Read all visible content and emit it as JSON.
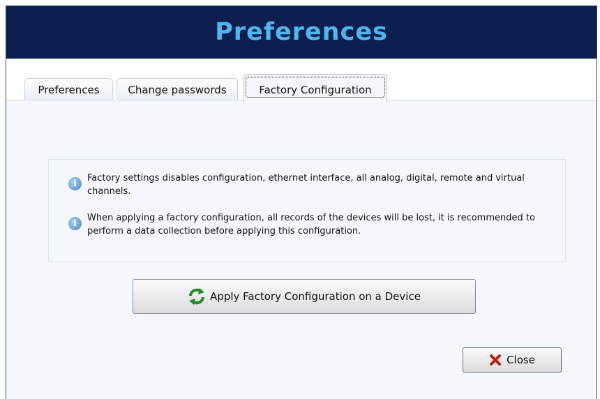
{
  "window": {
    "title": "Preferences"
  },
  "tabs": [
    {
      "label": "Preferences",
      "active": false
    },
    {
      "label": "Change passwords",
      "active": false
    },
    {
      "label": "Factory Configuration",
      "active": true
    }
  ],
  "info": {
    "icon": "info-icon",
    "messages": [
      "Factory settings disables configuration, ethernet interface, all analog, digital, remote and virtual channels.",
      "When applying a factory configuration, all records of the devices will be lost, it is recommended to perform a data collection before applying this configuration."
    ]
  },
  "apply_button": {
    "label": "Apply Factory Configuration on a Device",
    "icon": "refresh-icon"
  },
  "close_button": {
    "label": "Close",
    "icon": "close-icon"
  },
  "colors": {
    "title_bar": "#0c1f4e",
    "title_text": "#4fb6ee",
    "panel": "#f4f7fb"
  }
}
